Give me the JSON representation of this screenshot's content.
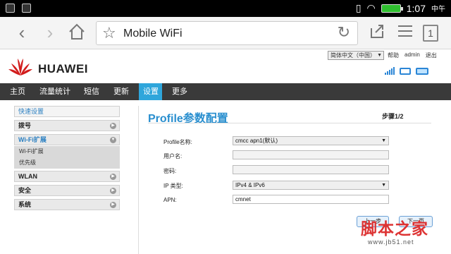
{
  "status_bar": {
    "time": "1:07",
    "ampm": "中午",
    "icons": [
      "notification-icon",
      "image-icon",
      "vibrate-icon",
      "wifi-icon",
      "battery-icon"
    ]
  },
  "browser": {
    "url_text": "Mobile WiFi",
    "tab_count": "1",
    "icons": [
      "back-icon",
      "forward-icon",
      "home-icon",
      "bookmark-star-icon",
      "reload-icon",
      "share-icon",
      "menu-icon"
    ]
  },
  "header": {
    "brand": "HUAWEI",
    "language": "简体中文（中国）",
    "links": [
      "帮助",
      "admin",
      "退出"
    ]
  },
  "nav": {
    "items": [
      "主页",
      "流量统计",
      "短信",
      "更新",
      "设置",
      "更多"
    ],
    "active": "设置"
  },
  "sidebar": {
    "quick_setup": "快速设置",
    "dialup": "拨号",
    "wifi_ext": "Wi-Fi扩展",
    "wifi_sub1": "Wi-Fi扩展",
    "wifi_sub2": "优先级",
    "wlan": "WLAN",
    "security": "安全",
    "system": "系统"
  },
  "main": {
    "title": "Profile参数配置",
    "step": "步骤1/2",
    "fields": {
      "profile_label": "Profile名称:",
      "profile_value": "cmcc apn1(默认)",
      "username_label": "用户名:",
      "username_value": "",
      "password_label": "密码:",
      "password_value": "",
      "iptype_label": "IP 类型:",
      "iptype_value": "IPv4 & IPv6",
      "apn_label": "APN:",
      "apn_value": "cmnet"
    },
    "buttons": {
      "prev": "上一步",
      "next": "下一页"
    }
  },
  "watermark": {
    "line1": "脚本之家",
    "line2": "www.jb51.net"
  }
}
